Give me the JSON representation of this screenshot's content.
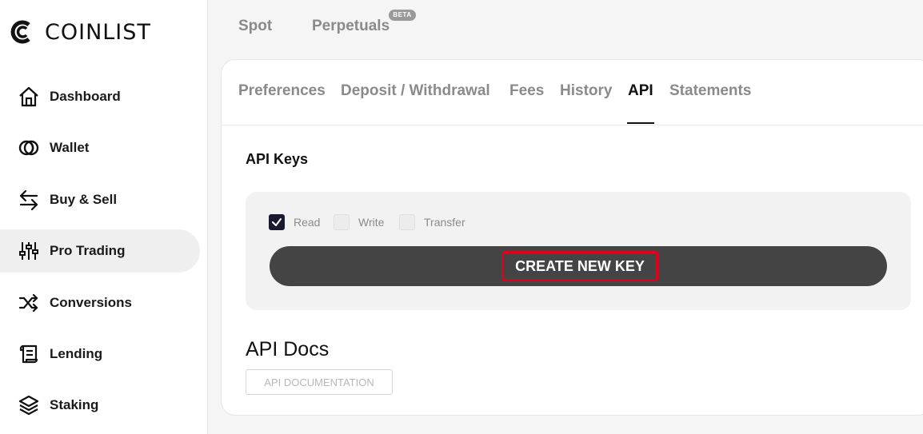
{
  "brand": {
    "name": "COINLIST"
  },
  "sidebar": {
    "items": [
      {
        "label": "Dashboard",
        "icon": "house-icon"
      },
      {
        "label": "Wallet",
        "icon": "wallet-rings-icon"
      },
      {
        "label": "Buy & Sell",
        "icon": "swap-arrows-icon"
      },
      {
        "label": "Pro Trading",
        "icon": "sliders-icon",
        "active": true
      },
      {
        "label": "Conversions",
        "icon": "shuffle-icon"
      },
      {
        "label": "Lending",
        "icon": "scroll-icon"
      },
      {
        "label": "Staking",
        "icon": "layers-icon"
      }
    ]
  },
  "market_tabs": {
    "spot": "Spot",
    "perpetuals": "Perpetuals",
    "beta_badge": "BETA"
  },
  "settings_tabs": [
    {
      "label": "Preferences"
    },
    {
      "label": "Deposit / Withdrawal"
    },
    {
      "label": "Fees"
    },
    {
      "label": "History"
    },
    {
      "label": "API",
      "active": true
    },
    {
      "label": "Statements"
    }
  ],
  "api_keys": {
    "title": "API Keys",
    "permissions": [
      {
        "label": "Read",
        "checked": true
      },
      {
        "label": "Write",
        "checked": false
      },
      {
        "label": "Transfer",
        "checked": false
      }
    ],
    "create_button": "CREATE NEW KEY"
  },
  "api_docs": {
    "title": "API Docs",
    "button": "API DOCUMENTATION"
  },
  "colors": {
    "button_bg": "#444444",
    "highlight": "#e0001b",
    "active_nav_bg": "#efefef",
    "checkbox_checked": "#1a1a2e"
  }
}
